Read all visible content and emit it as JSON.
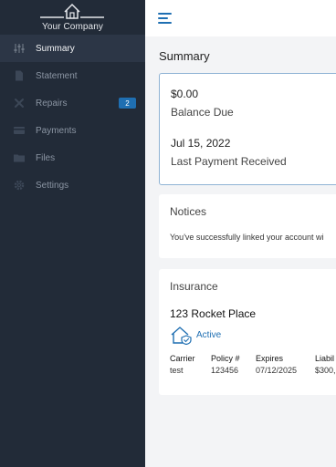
{
  "brand": {
    "name": "Your Company"
  },
  "sidebar": {
    "items": [
      {
        "label": "Summary"
      },
      {
        "label": "Statement"
      },
      {
        "label": "Repairs",
        "badge": "2"
      },
      {
        "label": "Payments"
      },
      {
        "label": "Files"
      },
      {
        "label": "Settings"
      }
    ]
  },
  "main": {
    "title": "Summary",
    "balance": {
      "amount": "$0.00",
      "amount_label": "Balance Due",
      "date": "Jul 15, 2022",
      "date_label": "Last Payment Received"
    },
    "notices": {
      "title": "Notices",
      "text": "You've successfully linked your account wi"
    },
    "insurance": {
      "title": "Insurance",
      "property": "123 Rocket Place",
      "status": "Active",
      "columns": [
        {
          "header": "Carrier",
          "value": "test"
        },
        {
          "header": "Policy #",
          "value": "123456"
        },
        {
          "header": "Expires",
          "value": "07/12/2025"
        },
        {
          "header": "Liabil",
          "value": "$300,"
        }
      ]
    }
  },
  "colors": {
    "sidebar": "#222b38",
    "accent": "#1f6fb2",
    "background": "#f3f4f6"
  }
}
